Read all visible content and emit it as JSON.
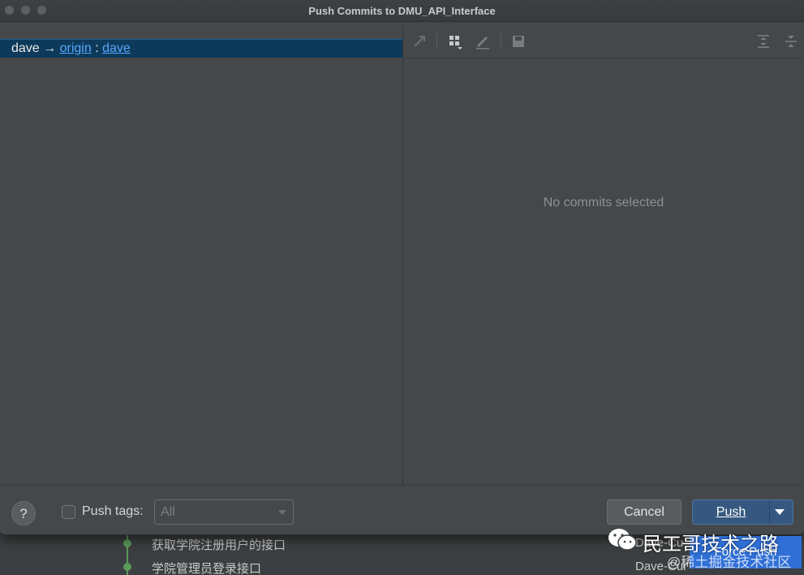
{
  "window": {
    "title": "Push Commits to DMU_API_Interface"
  },
  "branch": {
    "local": "dave",
    "arrow": "→",
    "remote": "origin",
    "separator": ":",
    "remote_branch": "dave"
  },
  "details": {
    "empty_message": "No commits selected"
  },
  "toolbar": {
    "icons": [
      "expand-icon",
      "group-by-icon",
      "edit-icon",
      "save-icon",
      "expand-all-icon",
      "collapse-all-icon"
    ]
  },
  "footer": {
    "help_label": "?",
    "push_tags_label": "Push tags:",
    "push_tags_checked": false,
    "tags_select_value": "All",
    "cancel_label": "Cancel",
    "push_label": "Push",
    "force_push_label": "Force Push"
  },
  "background_log": {
    "rows": [
      {
        "message": "获取学院注册用户的接口",
        "author": "Dave-Cu"
      },
      {
        "message": "学院管理员登录接口",
        "author": "Dave-Cur"
      }
    ]
  },
  "watermark": {
    "name": "民工哥技术之路",
    "sub": "@稀土掘金技术社区"
  },
  "colors": {
    "dialog_bg": "#45484a",
    "selection_bg": "#0d3a5a",
    "link": "#5aa7ff",
    "primary_button": "#365880"
  }
}
